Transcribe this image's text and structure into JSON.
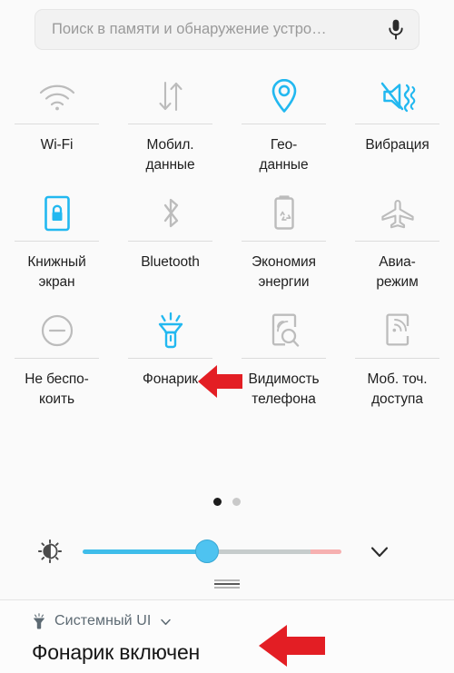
{
  "search": {
    "placeholder": "Поиск в памяти и обнаружение устро…",
    "mic_icon": "microphone-icon"
  },
  "quick_settings": {
    "accent_on_color": "#22b8f0",
    "off_color": "#b6b6b6",
    "rows": [
      [
        {
          "label": "Wi-Fi",
          "icon": "wifi-icon",
          "state": "off"
        },
        {
          "label": "Мобил.\nданные",
          "icon": "mobile-data-icon",
          "state": "off"
        },
        {
          "label": "Гео-\nданные",
          "icon": "location-pin-icon",
          "state": "on"
        },
        {
          "label": "Вибрация",
          "icon": "vibration-icon",
          "state": "on"
        }
      ],
      [
        {
          "label": "Книжный\nэкран",
          "icon": "rotation-lock-icon",
          "state": "on"
        },
        {
          "label": "Bluetooth",
          "icon": "bluetooth-icon",
          "state": "off"
        },
        {
          "label": "Экономия\nэнергии",
          "icon": "battery-saver-icon",
          "state": "off"
        },
        {
          "label": "Авиа-\nрежим",
          "icon": "airplane-icon",
          "state": "off"
        }
      ],
      [
        {
          "label": "Не беспо-\nкоить",
          "icon": "do-not-disturb-icon",
          "state": "off"
        },
        {
          "label": "Фонарик",
          "icon": "flashlight-icon",
          "state": "on"
        },
        {
          "label": "Видимость\nтелефона",
          "icon": "phone-visibility-icon",
          "state": "off"
        },
        {
          "label": "Моб. точ.\nдоступа",
          "icon": "hotspot-icon",
          "state": "off"
        }
      ]
    ]
  },
  "pager": {
    "pages": 2,
    "active_index": 0
  },
  "brightness": {
    "icon": "auto-brightness-sun-icon",
    "value_percent": 48,
    "warn_start_percent": 88,
    "fill_color": "#3fbdea",
    "track_color": "#c6cccc",
    "warn_color": "#f6b0b0",
    "expand_icon": "chevron-down-icon"
  },
  "drag_handle": "panel-drag-handle",
  "notification": {
    "app_icon": "flashlight-icon",
    "app_name": "Системный UI",
    "expand_icon": "chevron-down-icon",
    "title": "Фонарик включен"
  },
  "annotations": {
    "color": "#e31e24",
    "arrows": [
      {
        "name": "arrow-pointing-to-flashlight-tile",
        "direction": "left"
      },
      {
        "name": "arrow-pointing-to-notification",
        "direction": "left"
      }
    ]
  }
}
